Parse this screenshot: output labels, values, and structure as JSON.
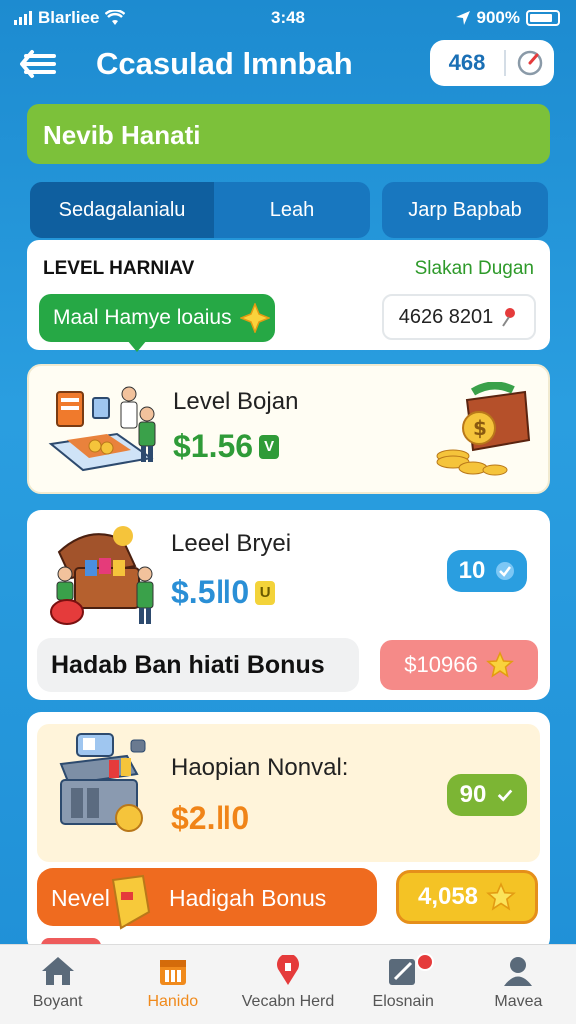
{
  "status": {
    "carrier": "Blarliee",
    "time": "3:48",
    "battery": "900%"
  },
  "header": {
    "title": "Ccasulad lmnbah",
    "count": "468"
  },
  "banner": {
    "text": "Nevib Hanati"
  },
  "tabs": [
    {
      "label": "Sedagalanialu"
    },
    {
      "label": "Leah"
    },
    {
      "label": "Jarp Bapbab"
    }
  ],
  "level": {
    "title": "LEVEL HARNIAV",
    "link": "Slakan Dugan",
    "pill": "Maal Hamye loaius",
    "code": "4626 8201"
  },
  "cards": [
    {
      "title": "Level Bojan",
      "amount": "$1.56",
      "tag": "V",
      "color": "#2f9b38"
    },
    {
      "title": "Leeel Bryei",
      "amount": "$.5‖0",
      "tag": "U",
      "color": "#2a8fd6",
      "badge": "10",
      "bonus_label": "Hadab Ban hiati Bonus",
      "bonus_value": "$10966"
    },
    {
      "title": "Haopian Nonval:",
      "amount": "$2.‖0",
      "color": "#f08418",
      "badge": "90",
      "bar_left": "Nevel",
      "bar_right": "Hadigah Bonus",
      "gold_value": "4,058"
    }
  ],
  "nav": [
    {
      "label": "Boyant",
      "icon": "home-icon"
    },
    {
      "label": "Hanido",
      "icon": "calendar-icon"
    },
    {
      "label": "Vecabn Herd",
      "icon": "location-icon"
    },
    {
      "label": "Elosnain",
      "icon": "edit-icon"
    },
    {
      "label": "Mavea",
      "icon": "user-icon"
    }
  ]
}
